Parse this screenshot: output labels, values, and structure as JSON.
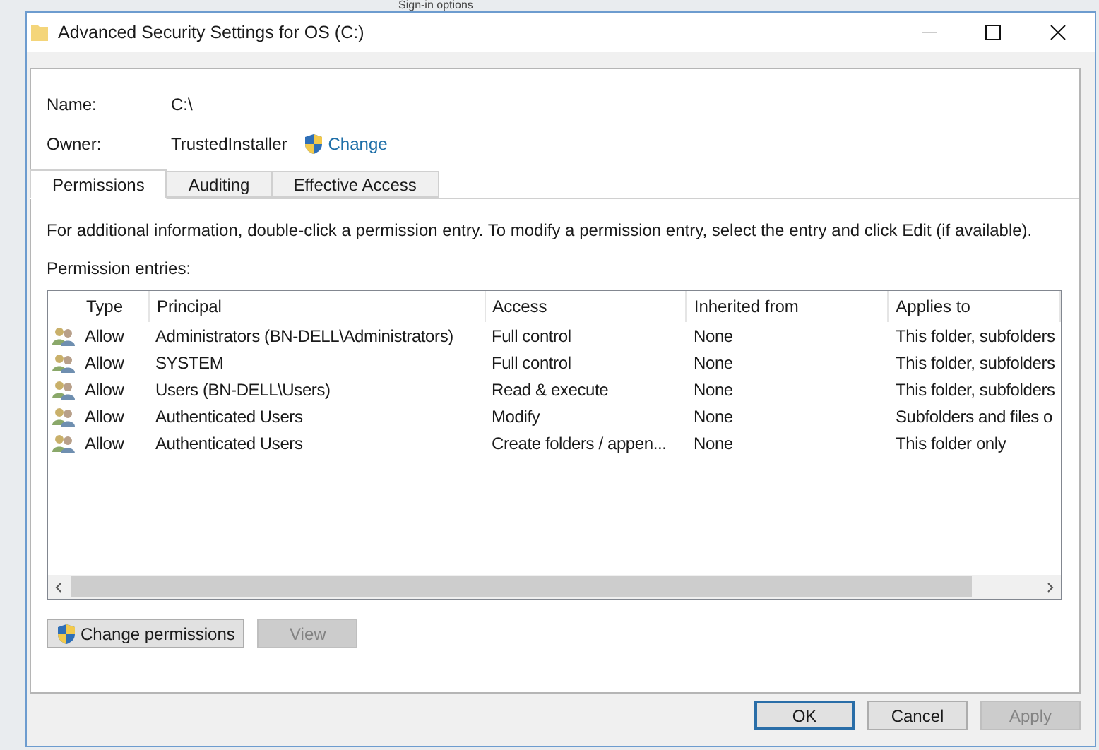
{
  "background": {
    "heading": "Sign-in options"
  },
  "window": {
    "title": "Advanced Security Settings for OS (C:)"
  },
  "name": {
    "label": "Name:",
    "value": "C:\\"
  },
  "owner": {
    "label": "Owner:",
    "value": "TrustedInstaller",
    "link": "Change"
  },
  "tabs": [
    {
      "label": "Permissions",
      "selected": true
    },
    {
      "label": "Auditing",
      "selected": false
    },
    {
      "label": "Effective Access",
      "selected": false
    }
  ],
  "info": "For additional information, double-click a permission entry. To modify a permission entry, select the entry and click Edit (if available).",
  "entries_label": "Permission entries:",
  "table": {
    "columns": [
      "Type",
      "Principal",
      "Access",
      "Inherited from",
      "Applies to"
    ],
    "rows": [
      [
        "Allow",
        "Administrators (BN-DELL\\Administrators)",
        "Full control",
        "None",
        "This folder, subfolders"
      ],
      [
        "Allow",
        "SYSTEM",
        "Full control",
        "None",
        "This folder, subfolders"
      ],
      [
        "Allow",
        "Users (BN-DELL\\Users)",
        "Read & execute",
        "None",
        "This folder, subfolders"
      ],
      [
        "Allow",
        "Authenticated Users",
        "Modify",
        "None",
        "Subfolders and files o"
      ],
      [
        "Allow",
        "Authenticated Users",
        "Create folders / appen...",
        "None",
        "This folder only"
      ]
    ]
  },
  "actions": [
    {
      "label": "Change permissions",
      "shield": true,
      "disabled": false
    },
    {
      "label": "View",
      "shield": false,
      "disabled": true
    }
  ],
  "buttons": [
    {
      "label": "OK",
      "default": true,
      "disabled": false
    },
    {
      "label": "Cancel",
      "default": false,
      "disabled": false
    },
    {
      "label": "Apply",
      "default": false,
      "disabled": true
    }
  ]
}
